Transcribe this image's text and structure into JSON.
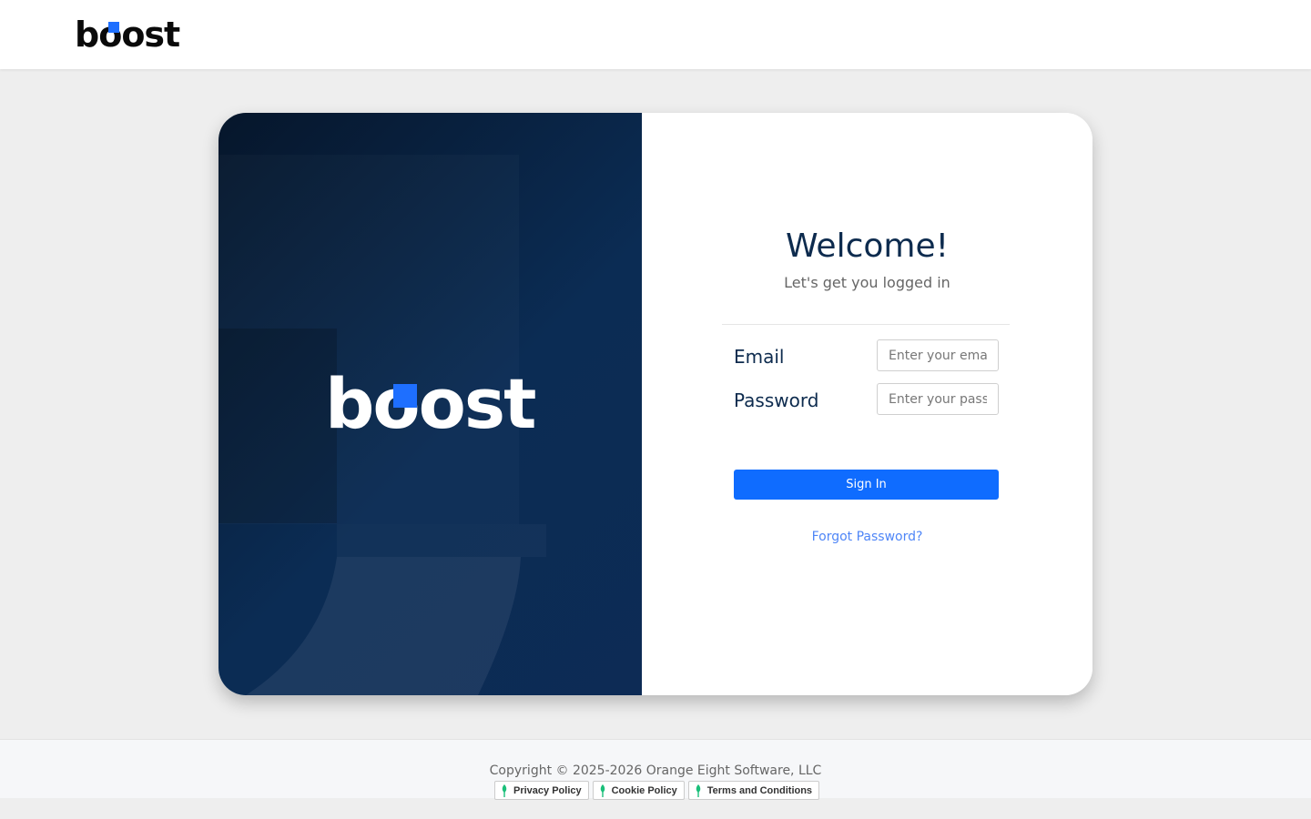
{
  "header": {
    "logo_text_b": "b",
    "logo_text_o": "o",
    "logo_text_rest": "ost",
    "accent_color": "#1e6fff"
  },
  "hero": {
    "logo_text_b": "b",
    "logo_text_o": "o",
    "logo_text_rest": "ost"
  },
  "login": {
    "title": "Welcome!",
    "subtitle": "Let's get you logged in",
    "email_label": "Email",
    "email_placeholder": "Enter your email",
    "password_label": "Password",
    "password_placeholder": "Enter your password",
    "signin_label": "Sign In",
    "forgot_label": "Forgot Password?",
    "button_color": "#0f6cff",
    "link_color": "#4f86f7"
  },
  "footer": {
    "copyright": "Copyright © 2025-2026 Orange Eight Software, LLC",
    "links": [
      {
        "label": "Privacy Policy",
        "icon": "leaf-icon"
      },
      {
        "label": "Cookie Policy",
        "icon": "leaf-icon"
      },
      {
        "label": "Terms and Conditions",
        "icon": "leaf-icon"
      }
    ]
  }
}
